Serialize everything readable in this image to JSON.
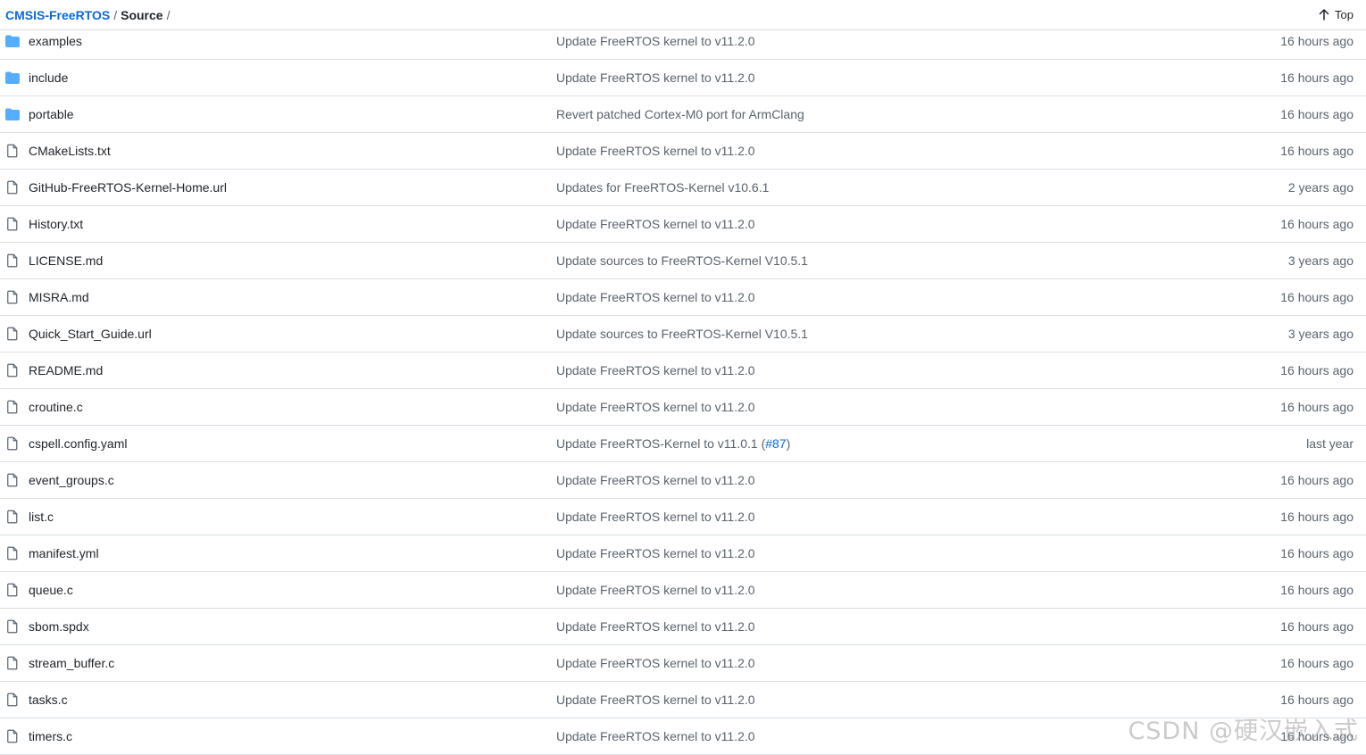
{
  "breadcrumb": {
    "repo": "CMSIS-FreeRTOS",
    "separator": "/",
    "current": "Source",
    "trailing": "/"
  },
  "top_link": {
    "label": "Top",
    "icon": "arrow-up-icon"
  },
  "accent_color": "#0969da",
  "folder_color": "#54aeff",
  "files": [
    {
      "type": "dir",
      "name": "examples",
      "message": "Update FreeRTOS kernel to v11.2.0",
      "pr": "",
      "age": "16 hours ago"
    },
    {
      "type": "dir",
      "name": "include",
      "message": "Update FreeRTOS kernel to v11.2.0",
      "pr": "",
      "age": "16 hours ago"
    },
    {
      "type": "dir",
      "name": "portable",
      "message": "Revert patched Cortex-M0 port for ArmClang",
      "pr": "",
      "age": "16 hours ago"
    },
    {
      "type": "file",
      "name": "CMakeLists.txt",
      "message": "Update FreeRTOS kernel to v11.2.0",
      "pr": "",
      "age": "16 hours ago"
    },
    {
      "type": "file",
      "name": "GitHub-FreeRTOS-Kernel-Home.url",
      "message": "Updates for FreeRTOS-Kernel v10.6.1",
      "pr": "",
      "age": "2 years ago"
    },
    {
      "type": "file",
      "name": "History.txt",
      "message": "Update FreeRTOS kernel to v11.2.0",
      "pr": "",
      "age": "16 hours ago"
    },
    {
      "type": "file",
      "name": "LICENSE.md",
      "message": "Update sources to FreeRTOS-Kernel V10.5.1",
      "pr": "",
      "age": "3 years ago"
    },
    {
      "type": "file",
      "name": "MISRA.md",
      "message": "Update FreeRTOS kernel to v11.2.0",
      "pr": "",
      "age": "16 hours ago"
    },
    {
      "type": "file",
      "name": "Quick_Start_Guide.url",
      "message": "Update sources to FreeRTOS-Kernel V10.5.1",
      "pr": "",
      "age": "3 years ago"
    },
    {
      "type": "file",
      "name": "README.md",
      "message": "Update FreeRTOS kernel to v11.2.0",
      "pr": "",
      "age": "16 hours ago"
    },
    {
      "type": "file",
      "name": "croutine.c",
      "message": "Update FreeRTOS kernel to v11.2.0",
      "pr": "",
      "age": "16 hours ago"
    },
    {
      "type": "file",
      "name": "cspell.config.yaml",
      "message": "Update FreeRTOS-Kernel to v11.0.1 (",
      "pr": "#87",
      "msg_suffix": ")",
      "age": "last year"
    },
    {
      "type": "file",
      "name": "event_groups.c",
      "message": "Update FreeRTOS kernel to v11.2.0",
      "pr": "",
      "age": "16 hours ago"
    },
    {
      "type": "file",
      "name": "list.c",
      "message": "Update FreeRTOS kernel to v11.2.0",
      "pr": "",
      "age": "16 hours ago"
    },
    {
      "type": "file",
      "name": "manifest.yml",
      "message": "Update FreeRTOS kernel to v11.2.0",
      "pr": "",
      "age": "16 hours ago"
    },
    {
      "type": "file",
      "name": "queue.c",
      "message": "Update FreeRTOS kernel to v11.2.0",
      "pr": "",
      "age": "16 hours ago"
    },
    {
      "type": "file",
      "name": "sbom.spdx",
      "message": "Update FreeRTOS kernel to v11.2.0",
      "pr": "",
      "age": "16 hours ago"
    },
    {
      "type": "file",
      "name": "stream_buffer.c",
      "message": "Update FreeRTOS kernel to v11.2.0",
      "pr": "",
      "age": "16 hours ago"
    },
    {
      "type": "file",
      "name": "tasks.c",
      "message": "Update FreeRTOS kernel to v11.2.0",
      "pr": "",
      "age": "16 hours ago"
    },
    {
      "type": "file",
      "name": "timers.c",
      "message": "Update FreeRTOS kernel to v11.2.0",
      "pr": "",
      "age": "16 hours ago"
    }
  ],
  "watermark": "CSDN @硬汉嵌入式"
}
